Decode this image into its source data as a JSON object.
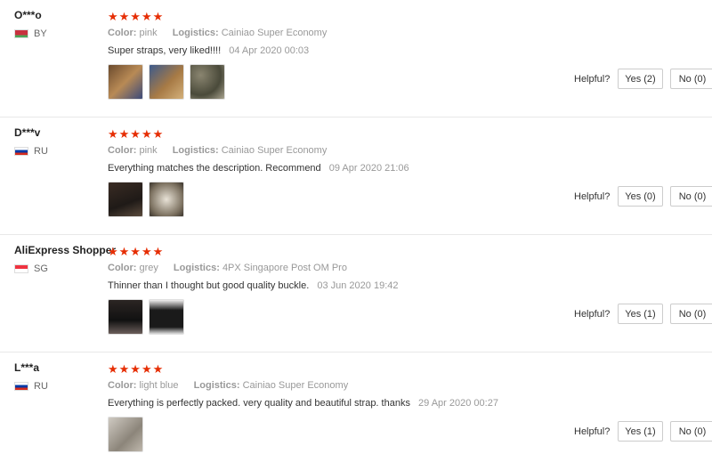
{
  "helpful_label": "Helpful?",
  "reviews": [
    {
      "user": "O***o",
      "country": "BY",
      "flag": "BY",
      "stars": "★★★★★",
      "color_key": "Color:",
      "color_value": "pink",
      "logistics_key": "Logistics:",
      "logistics_value": "Cainiao Super Economy",
      "text": "Super straps, very liked!!!!",
      "date": "04 Apr 2020 00:03",
      "yes": "Yes (2)",
      "no": "No (0)",
      "thumbs": [
        "t-brown1",
        "t-brown2",
        "t-camo"
      ]
    },
    {
      "user": "D***v",
      "country": "RU",
      "flag": "RU",
      "stars": "★★★★★",
      "color_key": "Color:",
      "color_value": "pink",
      "logistics_key": "Logistics:",
      "logistics_value": "Cainiao Super Economy",
      "text": "Everything matches the description. Recommend",
      "date": "09 Apr 2020 21:06",
      "yes": "Yes (0)",
      "no": "No (0)",
      "thumbs": [
        "t-dark",
        "t-white"
      ]
    },
    {
      "user": "AliExpress Shopper",
      "country": "SG",
      "flag": "SG",
      "stars": "★★★★★",
      "color_key": "Color:",
      "color_value": "grey",
      "logistics_key": "Logistics:",
      "logistics_value": "4PX Singapore Post OM Pro",
      "text": "Thinner than I thought but good quality buckle.",
      "date": "03 Jun 2020 19:42",
      "yes": "Yes (1)",
      "no": "No (0)",
      "thumbs": [
        "t-black1",
        "t-black2"
      ]
    },
    {
      "user": "L***a",
      "country": "RU",
      "flag": "RU",
      "stars": "★★★★★",
      "color_key": "Color:",
      "color_value": "light blue",
      "logistics_key": "Logistics:",
      "logistics_value": "Cainiao Super Economy",
      "text": "Everything is perfectly packed. very quality and beautiful strap. thanks",
      "date": "29 Apr 2020 00:27",
      "yes": "Yes (1)",
      "no": "No (0)",
      "thumbs": [
        "t-grey"
      ]
    }
  ]
}
